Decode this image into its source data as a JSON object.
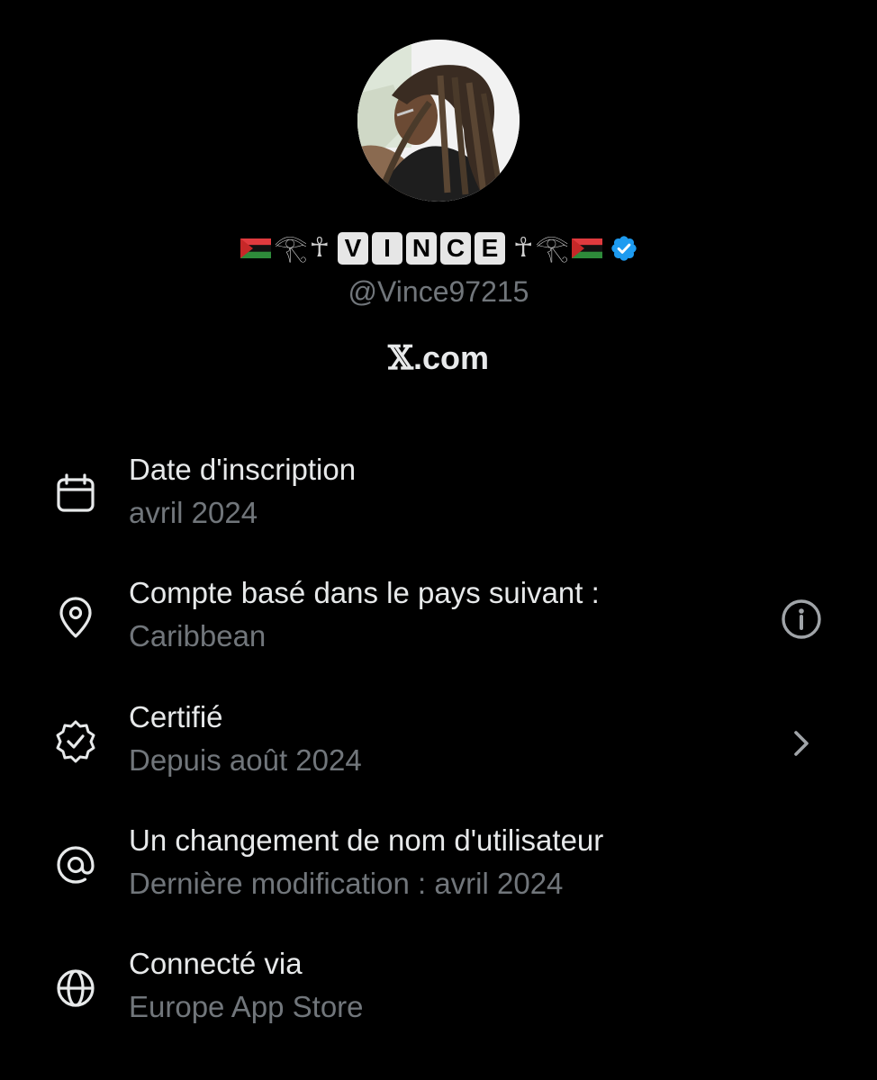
{
  "profile": {
    "display_name_letters": [
      "V",
      "I",
      "N",
      "C",
      "E"
    ],
    "display_name_glyphs": {
      "eye": "𓂀",
      "ankh": "☥"
    },
    "flag_colors": [
      "#e03a3e",
      "#111111",
      "#2e8b3a"
    ],
    "verified_color": "#1d9bf0",
    "handle": "@Vince97215",
    "site_logo": "𝕏",
    "site_suffix": ".com"
  },
  "about": {
    "items": [
      {
        "icon": "calendar-icon",
        "title": "Date d'inscription",
        "subtitle": "avril 2024"
      },
      {
        "icon": "location-pin-icon",
        "title": "Compte basé dans le pays suivant :",
        "subtitle": "Caribbean",
        "trailing_icon": "info-icon"
      },
      {
        "icon": "verified-badge-icon",
        "title": "Certifié",
        "subtitle": "Depuis août 2024",
        "trailing_icon": "chevron-right-icon"
      },
      {
        "icon": "at-sign-icon",
        "title": "Un changement de nom d'utilisateur",
        "subtitle": "Dernière modification : avril 2024"
      },
      {
        "icon": "globe-icon",
        "title": "Connecté via",
        "subtitle": "Europe App Store"
      }
    ]
  },
  "colors": {
    "background": "#000000",
    "primary_text": "#e7e9ea",
    "secondary_text": "#71767b"
  }
}
